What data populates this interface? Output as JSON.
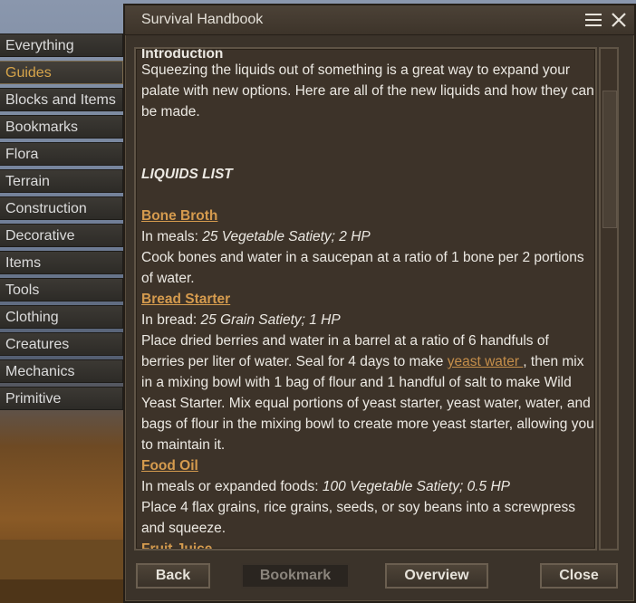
{
  "sidebar": {
    "items": [
      {
        "label": "Everything"
      },
      {
        "label": "Guides"
      },
      {
        "label": "Blocks and Items"
      },
      {
        "label": "Bookmarks"
      },
      {
        "label": "Flora"
      },
      {
        "label": "Terrain"
      },
      {
        "label": "Construction"
      },
      {
        "label": "Decorative"
      },
      {
        "label": "Items"
      },
      {
        "label": "Tools"
      },
      {
        "label": "Clothing"
      },
      {
        "label": "Creatures"
      },
      {
        "label": "Mechanics"
      },
      {
        "label": "Primitive"
      }
    ],
    "active_index": 1
  },
  "dialog": {
    "title": "Survival Handbook",
    "menu_icon": "hamburger-icon",
    "close_icon": "close-icon"
  },
  "content": {
    "intro_heading": "Introduction",
    "intro_text": "Squeezing the liquids out of something is a great way to expand your palate with new options. Here are all of the new liquids and how they can be made.",
    "list_title": "LIQUIDS LIST",
    "entries": [
      {
        "title": "Bone Broth",
        "stats_prefix": "In meals: ",
        "stats": "25 Vegetable Satiety; 2 HP",
        "desc": "Cook bones and water in a saucepan at a ratio of 1 bone per 2 portions of water."
      },
      {
        "title": "Bread Starter",
        "stats_prefix": "In bread: ",
        "stats": "25 Grain Satiety; 1 HP",
        "desc_before_link": "Place dried berries and water in a barrel at a ratio of 6 handfuls of berries per liter of water. Seal for 4 days to make ",
        "link": "yeast water ",
        "desc_after_link": ", then mix in a mixing bowl with 1 bag of flour and 1 handful of salt to make Wild Yeast Starter. Mix equal portions of yeast starter, yeast water, water, and bags of flour in the mixing bowl to create more yeast starter, allowing you to maintain it."
      },
      {
        "title": "Food Oil",
        "stats_prefix": "In meals or expanded foods: ",
        "stats": "100 Vegetable Satiety; 0.5 HP",
        "desc": "Place 4 flax grains, rice grains, seeds, or soy beans into a screwpress and squeeze."
      },
      {
        "title": "Fruit Juice"
      }
    ]
  },
  "buttons": {
    "back": "Back",
    "bookmark": "Bookmark",
    "overview": "Overview",
    "close": "Close"
  },
  "colors": {
    "accent": "#d59b4e",
    "active_sidebar": "#d6a44a",
    "panel_bg": "#3b332a"
  }
}
